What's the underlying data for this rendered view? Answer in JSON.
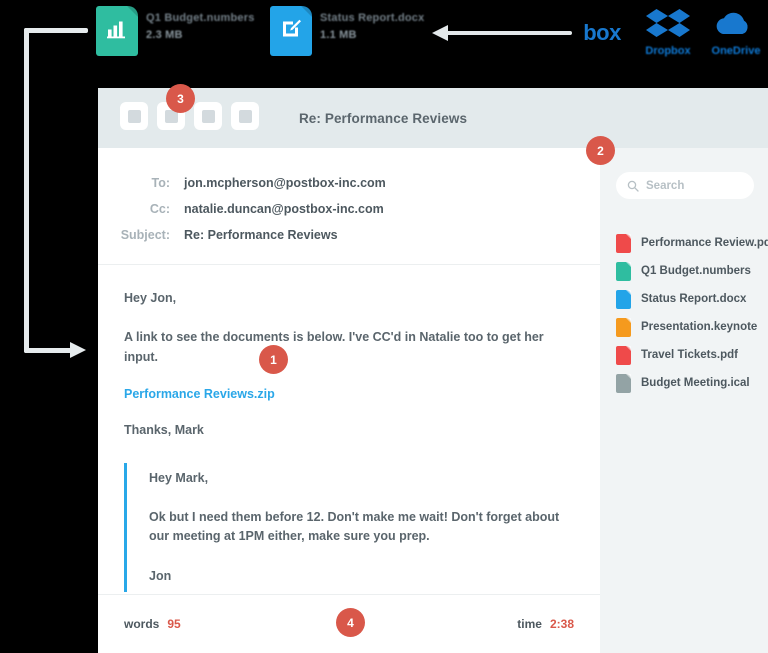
{
  "colors": {
    "badge": "#d9584a",
    "link": "#2aa7e8",
    "quote_rule": "#29a8e8",
    "titlebar": "#e3eaec",
    "sidebar": "#f1f4f5",
    "connector": "#e6ebed",
    "icon_numbers": "#2fbda0",
    "icon_docx": "#23a4e8",
    "icon_pdf": "#ef4a4a",
    "icon_keynote": "#f59a1e",
    "icon_ical": "#93a3a5",
    "cloud_blue": "#1878ce"
  },
  "top_strip": {
    "files": [
      {
        "icon": "numbers-file-icon",
        "icon_glyph": "bar-chart-glyph",
        "icon_color": "#2fbda0",
        "name": "Q1 Budget.numbers",
        "size": "2.3 MB"
      },
      {
        "icon": "docx-file-icon",
        "icon_glyph": "pencil-edit-glyph",
        "icon_color": "#23a4e8",
        "name": "Status Report.docx",
        "size": "1.1 MB"
      }
    ],
    "arrow": {
      "name": "arrow-left",
      "direction": "left"
    },
    "cloud_services": [
      {
        "id": "box-logo",
        "wordmark": "box",
        "sub": ""
      },
      {
        "id": "dropbox-logo",
        "wordmark": "",
        "sub": "Dropbox"
      },
      {
        "id": "onedrive-logo",
        "wordmark": "",
        "sub": "OneDrive"
      }
    ]
  },
  "connector": {
    "name": "elbow-connector-arrow",
    "direction": "right"
  },
  "window": {
    "title": "Re: Performance Reviews",
    "toolbar_buttons": [
      {
        "name": "toolbar-button-1",
        "label": ""
      },
      {
        "name": "toolbar-button-2",
        "label": ""
      },
      {
        "name": "toolbar-button-3",
        "label": ""
      },
      {
        "name": "toolbar-button-4",
        "label": ""
      }
    ]
  },
  "compose": {
    "fields": [
      {
        "label": "To:",
        "value": "jon.mcpherson@postbox-inc.com"
      },
      {
        "label": "Cc:",
        "value": "natalie.duncan@postbox-inc.com"
      },
      {
        "label": "Subject:",
        "value": "Re: Performance Reviews"
      }
    ],
    "body": {
      "greeting": "Hey Jon,",
      "paragraph": "A link to see the documents is below. I've CC'd in Natalie too to get her input.",
      "attachment_link": "Performance Reviews.zip",
      "signoff": "Thanks, Mark"
    },
    "quote": {
      "greeting": "Hey Mark,",
      "paragraph": "Ok but I need them before 12. Don't make me wait! Don't forget about our meeting at 1PM either, make sure you prep.",
      "signoff": "Jon"
    }
  },
  "footer": {
    "words_label": "words",
    "words_value": "95",
    "time_label": "time",
    "time_value": "2:38"
  },
  "sidebar": {
    "search": {
      "placeholder": "Search",
      "value": ""
    },
    "files": [
      {
        "name": "Performance Review.pdf",
        "color": "#ef4a4a",
        "icon": "pdf-file-icon"
      },
      {
        "name": "Q1 Budget.numbers",
        "color": "#2fbda0",
        "icon": "numbers-file-icon"
      },
      {
        "name": "Status Report.docx",
        "color": "#23a4e8",
        "icon": "docx-file-icon"
      },
      {
        "name": "Presentation.keynote",
        "color": "#f59a1e",
        "icon": "keynote-file-icon"
      },
      {
        "name": "Travel Tickets.pdf",
        "color": "#ef4a4a",
        "icon": "pdf-file-icon"
      },
      {
        "name": "Budget Meeting.ical",
        "color": "#93a3a5",
        "icon": "ical-file-icon"
      }
    ]
  },
  "badges": [
    {
      "id": 1,
      "label": "1"
    },
    {
      "id": 2,
      "label": "2"
    },
    {
      "id": 3,
      "label": "3"
    },
    {
      "id": 4,
      "label": "4"
    }
  ]
}
